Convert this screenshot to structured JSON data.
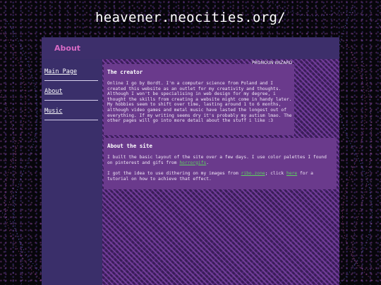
{
  "site_url": "heavener.neocities.org/",
  "header": {
    "title": "About"
  },
  "sidebar": {
    "items": [
      {
        "label": "Main Page"
      },
      {
        "label": "About"
      },
      {
        "label": "Music"
      }
    ]
  },
  "pronoun_badge": {
    "alt": "PRONOUN WIZARD"
  },
  "creator": {
    "title": "The creator",
    "body": "Online I go by Bordt. I'm a computer science from Poland and I created this website as an outlet for my creativity and thoughts. Although I won't be specialising in web design for my degree, i thought the skills from creating a website might come in handy later. My hobbies seem to shift over time, lasting around 1 to 6 months, although video games and metal music have lasted the longest out of everything. If my writing seems dry it's probably my autism lmao. The other pages will go into more detail about the stuff i like :3"
  },
  "site": {
    "title": "About the site",
    "p1_text": "I built the basic layout of the site over a few days. I use color palettes I found on pinterest and gifs from ",
    "p1_link": "horrorgifs",
    "p1_end": ".",
    "p2_text": "I got the idea to use dithering on my images from ",
    "p2_link1": "ribo.zone",
    "p2_mid": "; click ",
    "p2_link2": "here",
    "p2_end": " for a tutorial on how to achieve that effect."
  },
  "colors": {
    "background": "#07060b",
    "frame": "#2d2254",
    "header": "#3d2f6b",
    "header_text": "#d86ac5",
    "card": "#6a3a8c",
    "link_green": "#5fd35f"
  }
}
